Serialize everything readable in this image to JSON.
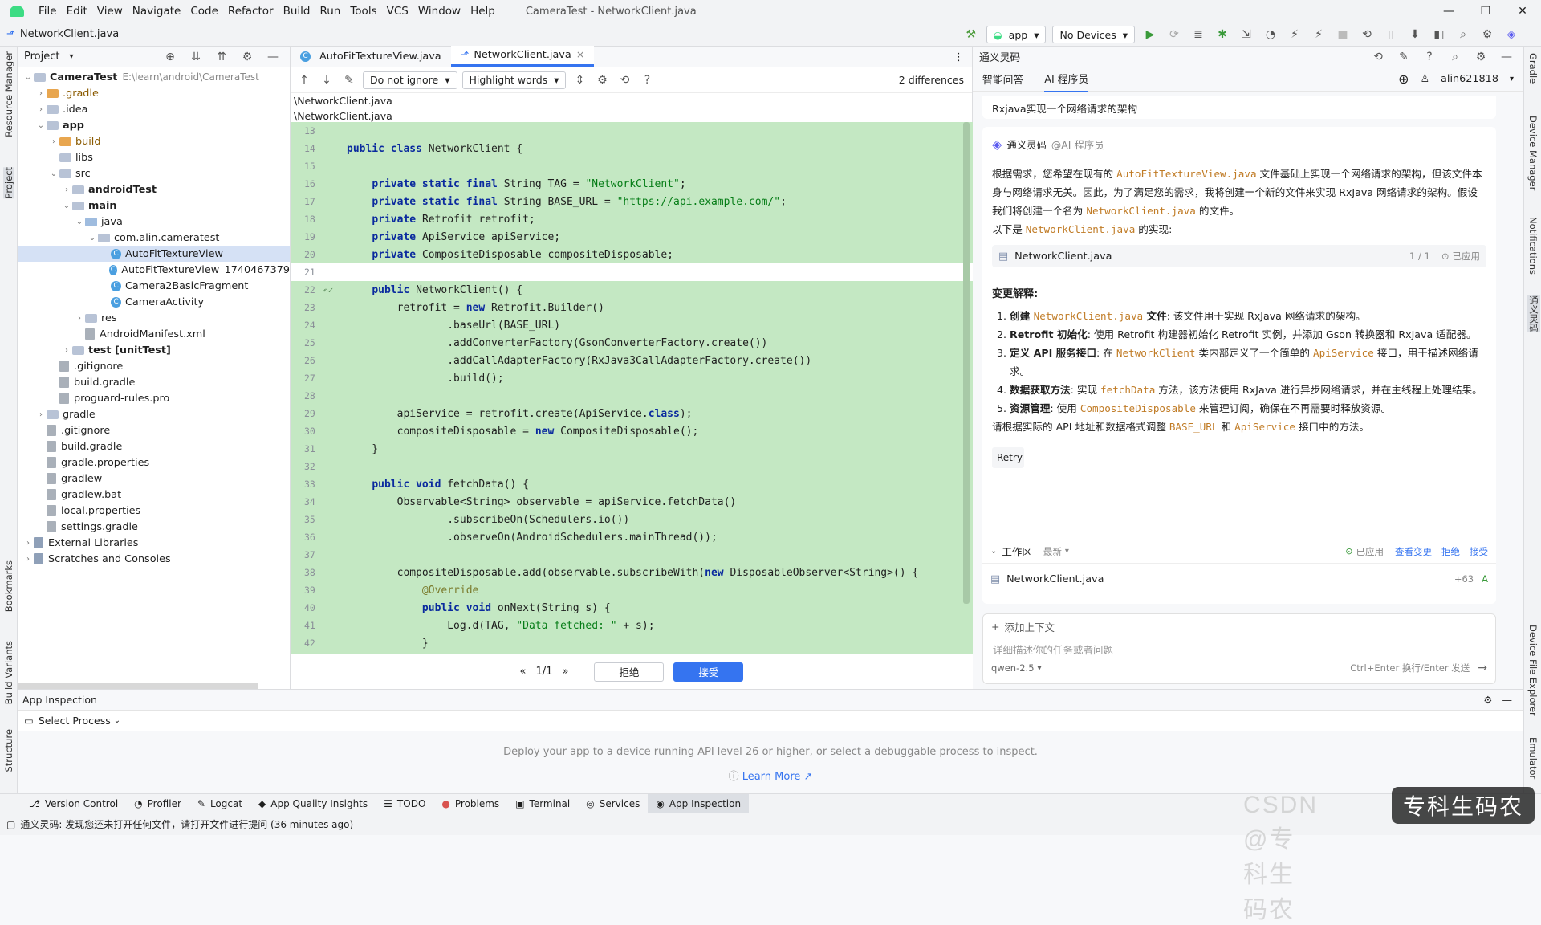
{
  "menubar": {
    "items": [
      "File",
      "Edit",
      "View",
      "Navigate",
      "Code",
      "Refactor",
      "Build",
      "Run",
      "Tools",
      "VCS",
      "Window",
      "Help"
    ],
    "window_title": "CameraTest - NetworkClient.java"
  },
  "navbar": {
    "breadcrumb": "NetworkClient.java",
    "run_config": "app",
    "device": "No Devices"
  },
  "left_strip": {
    "resource_manager": "Resource Manager",
    "project": "Project",
    "bookmarks": "Bookmarks",
    "build_variants": "Build Variants",
    "structure": "Structure"
  },
  "right_strip": {
    "gradle": "Gradle",
    "device_manager": "Device Manager",
    "notifications": "Notifications",
    "tongyi": "通义灵码",
    "device_file_explorer": "Device File Explorer",
    "emulator": "Emulator"
  },
  "project": {
    "header": "Project",
    "tree": [
      {
        "label": "CameraTest",
        "extra": "E:\\learn\\android\\CameraTest",
        "depth": 0,
        "arrow": "⌄",
        "icon": "folder"
      },
      {
        "label": ".gradle",
        "depth": 1,
        "arrow": "›",
        "icon": "folder-orange"
      },
      {
        "label": ".idea",
        "depth": 1,
        "arrow": "›",
        "icon": "folder"
      },
      {
        "label": "app",
        "depth": 1,
        "arrow": "⌄",
        "icon": "folder"
      },
      {
        "label": "build",
        "depth": 2,
        "arrow": "›",
        "icon": "folder-orange"
      },
      {
        "label": "libs",
        "depth": 2,
        "arrow": "",
        "icon": "folder"
      },
      {
        "label": "src",
        "depth": 2,
        "arrow": "⌄",
        "icon": "folder"
      },
      {
        "label": "androidTest",
        "depth": 3,
        "arrow": "›",
        "icon": "folder"
      },
      {
        "label": "main",
        "depth": 3,
        "arrow": "⌄",
        "icon": "folder"
      },
      {
        "label": "java",
        "depth": 4,
        "arrow": "⌄",
        "icon": "folder-blue"
      },
      {
        "label": "com.alin.cameratest",
        "depth": 5,
        "arrow": "⌄",
        "icon": "folder"
      },
      {
        "label": "AutoFitTextureView",
        "depth": 6,
        "arrow": "",
        "icon": "class"
      },
      {
        "label": "AutoFitTextureView_1740467379",
        "depth": 6,
        "arrow": "",
        "icon": "class"
      },
      {
        "label": "Camera2BasicFragment",
        "depth": 6,
        "arrow": "",
        "icon": "class"
      },
      {
        "label": "CameraActivity",
        "depth": 6,
        "arrow": "",
        "icon": "class"
      },
      {
        "label": "res",
        "depth": 4,
        "arrow": "›",
        "icon": "folder"
      },
      {
        "label": "AndroidManifest.xml",
        "depth": 4,
        "arrow": "",
        "icon": "file"
      },
      {
        "label": "test [unitTest]",
        "depth": 3,
        "arrow": "›",
        "icon": "folder"
      },
      {
        "label": ".gitignore",
        "depth": 2,
        "arrow": "",
        "icon": "file"
      },
      {
        "label": "build.gradle",
        "depth": 2,
        "arrow": "",
        "icon": "file"
      },
      {
        "label": "proguard-rules.pro",
        "depth": 2,
        "arrow": "",
        "icon": "file"
      },
      {
        "label": "gradle",
        "depth": 1,
        "arrow": "›",
        "icon": "folder"
      },
      {
        "label": ".gitignore",
        "depth": 1,
        "arrow": "",
        "icon": "file"
      },
      {
        "label": "build.gradle",
        "depth": 1,
        "arrow": "",
        "icon": "file"
      },
      {
        "label": "gradle.properties",
        "depth": 1,
        "arrow": "",
        "icon": "file"
      },
      {
        "label": "gradlew",
        "depth": 1,
        "arrow": "",
        "icon": "file"
      },
      {
        "label": "gradlew.bat",
        "depth": 1,
        "arrow": "",
        "icon": "file"
      },
      {
        "label": "local.properties",
        "depth": 1,
        "arrow": "",
        "icon": "file"
      },
      {
        "label": "settings.gradle",
        "depth": 1,
        "arrow": "",
        "icon": "file"
      },
      {
        "label": "External Libraries",
        "depth": 0,
        "arrow": "›",
        "icon": "lib"
      },
      {
        "label": "Scratches and Consoles",
        "depth": 0,
        "arrow": "›",
        "icon": "lib"
      }
    ]
  },
  "editor": {
    "tabs": [
      "AutoFitTextureView.java",
      "NetworkClient.java"
    ],
    "ignore": "Do not ignore",
    "highlight": "Highlight words",
    "diff_count": "2 differences",
    "path1": "\\NetworkClient.java",
    "path2": "\\NetworkClient.java",
    "lines": [
      {
        "n": "13",
        "t": []
      },
      {
        "n": "14",
        "t": [
          [
            "kw",
            "public class "
          ],
          [
            "",
            "NetworkClient {"
          ]
        ]
      },
      {
        "n": "15",
        "t": []
      },
      {
        "n": "16",
        "t": [
          [
            "",
            "    "
          ],
          [
            "kw",
            "private static final "
          ],
          [
            "",
            "String TAG = "
          ],
          [
            "st",
            "\"NetworkClient\""
          ],
          [
            "",
            ";"
          ]
        ]
      },
      {
        "n": "17",
        "t": [
          [
            "",
            "    "
          ],
          [
            "kw",
            "private static final "
          ],
          [
            "",
            "String BASE_URL = "
          ],
          [
            "st",
            "\"https://api.example.com/\""
          ],
          [
            "",
            ";"
          ]
        ]
      },
      {
        "n": "18",
        "t": [
          [
            "",
            "    "
          ],
          [
            "kw",
            "private "
          ],
          [
            "",
            "Retrofit retrofit;"
          ]
        ]
      },
      {
        "n": "19",
        "t": [
          [
            "",
            "    "
          ],
          [
            "kw",
            "private "
          ],
          [
            "",
            "ApiService apiService;"
          ]
        ]
      },
      {
        "n": "20",
        "t": [
          [
            "",
            "    "
          ],
          [
            "kw",
            "private "
          ],
          [
            "",
            "CompositeDisposable compositeDisposable;"
          ]
        ]
      },
      {
        "n": "21",
        "pre": "1",
        "t": [],
        "white": true
      },
      {
        "n": "22",
        "t": [
          [
            "",
            "    "
          ],
          [
            "kw",
            "public "
          ],
          [
            "",
            "NetworkClient() {"
          ]
        ]
      },
      {
        "n": "23",
        "t": [
          [
            "",
            "        retrofit = "
          ],
          [
            "kw",
            "new "
          ],
          [
            "",
            "Retrofit.Builder()"
          ]
        ]
      },
      {
        "n": "24",
        "t": [
          [
            "",
            "                .baseUrl(BASE_URL)"
          ]
        ]
      },
      {
        "n": "25",
        "t": [
          [
            "",
            "                .addConverterFactory(GsonConverterFactory.create())"
          ]
        ]
      },
      {
        "n": "26",
        "t": [
          [
            "",
            "                .addCallAdapterFactory(RxJava3CallAdapterFactory.create())"
          ]
        ]
      },
      {
        "n": "27",
        "t": [
          [
            "",
            "                .build();"
          ]
        ]
      },
      {
        "n": "28",
        "t": []
      },
      {
        "n": "29",
        "t": [
          [
            "",
            "        apiService = retrofit.create(ApiService."
          ],
          [
            "kw",
            "class"
          ],
          [
            "",
            ");"
          ]
        ]
      },
      {
        "n": "30",
        "t": [
          [
            "",
            "        compositeDisposable = "
          ],
          [
            "kw",
            "new "
          ],
          [
            "",
            "CompositeDisposable();"
          ]
        ]
      },
      {
        "n": "31",
        "t": [
          [
            "",
            "    }"
          ]
        ]
      },
      {
        "n": "32",
        "t": []
      },
      {
        "n": "33",
        "t": [
          [
            "",
            "    "
          ],
          [
            "kw",
            "public void "
          ],
          [
            "",
            "fetchData() {"
          ]
        ]
      },
      {
        "n": "34",
        "t": [
          [
            "",
            "        Observable<String> observable = apiService.fetchData()"
          ]
        ]
      },
      {
        "n": "35",
        "t": [
          [
            "",
            "                .subscribeOn(Schedulers.io())"
          ]
        ]
      },
      {
        "n": "36",
        "t": [
          [
            "",
            "                .observeOn(AndroidSchedulers.mainThread());"
          ]
        ]
      },
      {
        "n": "37",
        "t": []
      },
      {
        "n": "38",
        "t": [
          [
            "",
            "        compositeDisposable.add(observable.subscribeWith("
          ],
          [
            "kw",
            "new "
          ],
          [
            "",
            "DisposableObserver<String>() {"
          ]
        ]
      },
      {
        "n": "39",
        "t": [
          [
            "",
            "            "
          ],
          [
            "an",
            "@Override"
          ]
        ]
      },
      {
        "n": "40",
        "t": [
          [
            "",
            "            "
          ],
          [
            "kw",
            "public void "
          ],
          [
            "",
            "onNext(String s) {"
          ]
        ]
      },
      {
        "n": "41",
        "t": [
          [
            "",
            "                Log.d(TAG, "
          ],
          [
            "st",
            "\"Data fetched: \""
          ],
          [
            "",
            " + s);"
          ]
        ]
      },
      {
        "n": "42",
        "t": [
          [
            "",
            "            }"
          ]
        ]
      }
    ],
    "nav": "1/1",
    "reject": "拒绝",
    "accept": "接受"
  },
  "ai": {
    "header": "通义灵码",
    "tab1": "智能问答",
    "tab2": "AI 程序员",
    "user": "alin621818",
    "question": "Rxjava实现一个网络请求的架构",
    "bot_name": "通义灵码",
    "bot_role": "@AI 程序员",
    "p1a": "根据需求，您希望在现有的 ",
    "p1b": "AutoFitTextureView.java",
    "p1c": " 文件基础上实现一个网络请求的架构，但该文件本身与网络请求无关。因此，为了满足您的需求，我将创建一个新的文件来实现 RxJava 网络请求的架构。假设我们将创建一个名为 ",
    "p1d": "NetworkClient.java",
    "p1e": " 的文件。",
    "p2a": "以下是 ",
    "p2b": "NetworkClient.java",
    "p2c": " 的实现:",
    "file_name": "NetworkClient.java",
    "file_count": "1 / 1",
    "file_status": "已应用",
    "explain_title": "变更解释:",
    "items": [
      {
        "n": "1.",
        "b": "创建 ",
        "m": "NetworkClient.java",
        "b2": " 文件",
        "r": ": 该文件用于实现 RxJava 网络请求的架构。"
      },
      {
        "n": "2.",
        "b": "Retrofit 初始化",
        "r": ": 使用 Retrofit 构建器初始化 Retrofit 实例，并添加 Gson 转换器和 RxJava 适配器。"
      },
      {
        "n": "3.",
        "b": "定义 API 服务接口",
        "r1": ": 在 ",
        "m1": "NetworkClient",
        "r2": " 类内部定义了一个简单的 ",
        "m2": "ApiService",
        "r3": " 接口，用于描述网络请求。"
      },
      {
        "n": "4.",
        "b": "数据获取方法",
        "r1": ": 实现 ",
        "m1": "fetchData",
        "r2": " 方法，该方法使用 RxJava 进行异步网络请求，并在主线程上处理结果。"
      },
      {
        "n": "5.",
        "b": "资源管理",
        "r1": ": 使用 ",
        "m1": "CompositeDisposable",
        "r2": " 来管理订阅，确保在不再需要时释放资源。"
      }
    ],
    "tail_a": "请根据实际的 API 地址和数据格式调整 ",
    "tail_b": "BASE_URL",
    "tail_c": " 和 ",
    "tail_d": "ApiService",
    "tail_e": " 接口中的方法。",
    "retry": "Retry",
    "workspace": "工作区",
    "latest": "最新",
    "ws_status": "已应用",
    "ws_view": "查看变更",
    "ws_reject": "拒绝",
    "ws_accept": "接受",
    "ws_file": "NetworkClient.java",
    "ws_delta": "+63",
    "ws_flag": "A",
    "add_ctx": "添加上下文",
    "input_placeholder": "详细描述你的任务或者问题",
    "model": "qwen-2.5",
    "send_hint": "Ctrl+Enter 换行/Enter 发送"
  },
  "bottom": {
    "title": "App Inspection",
    "select": "Select Process",
    "message": "Deploy your app to a device running API level 26 or higher, or select a debuggable process to inspect.",
    "learn": "Learn More ↗"
  },
  "toolwindows": [
    "Version Control",
    "Profiler",
    "Logcat",
    "App Quality Insights",
    "TODO",
    "Problems",
    "Terminal",
    "Services",
    "App Inspection"
  ],
  "status": "通义灵码: 发现您还未打开任何文件，请打开文件进行提问 (36 minutes ago)",
  "watermark": {
    "csdn": "CSDN @专科生码农",
    "badge": "专科生码农"
  }
}
